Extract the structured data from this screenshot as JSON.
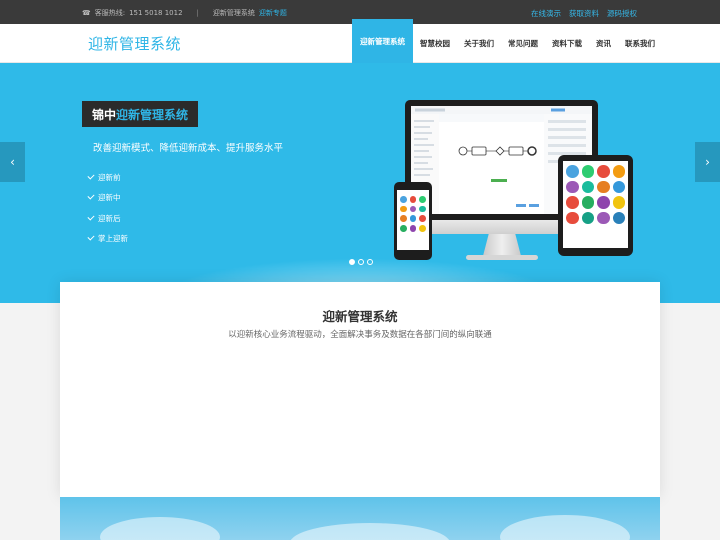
{
  "topbar": {
    "phone_label": "客服热线:",
    "phone": "151 5018 1012",
    "separator": "|",
    "product": "迎新管理系统",
    "product_link": "迎新专题",
    "links": [
      "在线演示",
      "获取资料",
      "源码授权"
    ]
  },
  "header": {
    "logo": "迎新管理系统",
    "nav": [
      "迎新管理系统",
      "智慧校园",
      "关于我们",
      "常见问题",
      "资料下载",
      "资讯",
      "联系我们"
    ]
  },
  "hero": {
    "title_prefix": "锦中",
    "title_accent": "迎新管理系统",
    "subtitle": "改善迎新模式、降低迎新成本、提升服务水平",
    "features": [
      "迎新前",
      "迎新中",
      "迎新后",
      "掌上迎新"
    ],
    "prev_arrow": "‹",
    "next_arrow": "›",
    "active_slide": 1,
    "slide_count": 3
  },
  "section": {
    "title": "迎新管理系统",
    "subtitle": "以迎新核心业务流程驱动，全面解决事务及数据在各部门间的纵向联通"
  },
  "colors": {
    "accent": "#2fb5e6",
    "hero_bg": "#2fbae8",
    "topbar_bg": "#3a3a3a"
  }
}
